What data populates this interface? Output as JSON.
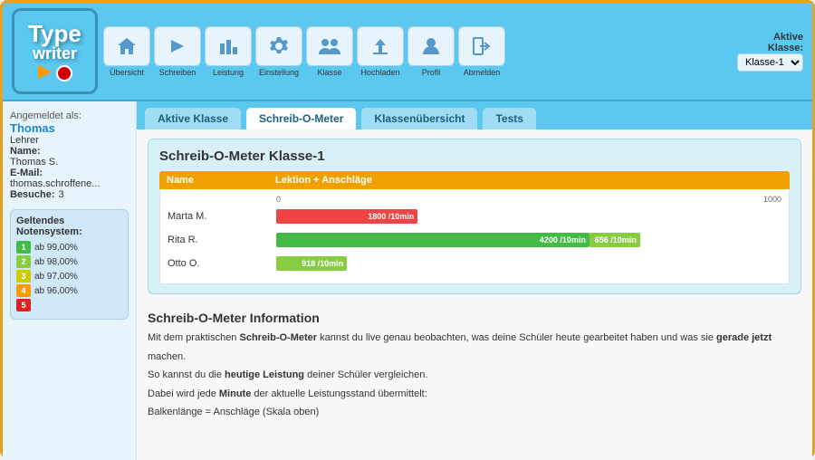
{
  "header": {
    "logo_line1": "Type",
    "logo_line2": "writer",
    "nav_items": [
      {
        "id": "uebersicht",
        "label": "Übersicht",
        "icon": "🏠"
      },
      {
        "id": "schreiben",
        "label": "Schreiben",
        "icon": "▶"
      },
      {
        "id": "leistung",
        "label": "Leistung",
        "icon": "🏛"
      },
      {
        "id": "einstellung",
        "label": "Einstellung",
        "icon": "🔧"
      },
      {
        "id": "klasse",
        "label": "Klasse",
        "icon": "👥"
      },
      {
        "id": "hochladen",
        "label": "Hochladen",
        "icon": "⬆"
      },
      {
        "id": "profil",
        "label": "Profil",
        "icon": "⚙"
      },
      {
        "id": "abmelden",
        "label": "Abmelden",
        "icon": "🚪"
      }
    ],
    "aktive_klasse_label": "Aktive\nKlasse:",
    "klasse_value": "Klasse-1"
  },
  "sidebar": {
    "angemeldet_label": "Angemeldet als:",
    "user_name": "Thomas",
    "role": "Lehrer",
    "name_label": "Name:",
    "name_value": "Thomas S.",
    "email_label": "E-Mail:",
    "email_value": "thomas.schroffene...",
    "besuche_label": "Besuche:",
    "besuche_value": "3",
    "grading_title": "Geltendes\nNotensystem:",
    "grades": [
      {
        "num": "1",
        "color": "#44bb44",
        "text": "ab 99,00%"
      },
      {
        "num": "2",
        "color": "#88cc44",
        "text": "ab 98,00%"
      },
      {
        "num": "3",
        "color": "#cccc00",
        "text": "ab 97,00%"
      },
      {
        "num": "4",
        "color": "#ff9900",
        "text": "ab 96,00%"
      },
      {
        "num": "5",
        "color": "#dd2222",
        "text": ""
      }
    ]
  },
  "tabs": [
    {
      "id": "aktive-klasse",
      "label": "Aktive Klasse",
      "active": false
    },
    {
      "id": "schreib-o-meter",
      "label": "Schreib-O-Meter",
      "active": true
    },
    {
      "id": "klassenuebersicht",
      "label": "Klassenübersicht",
      "active": false
    },
    {
      "id": "tests",
      "label": "Tests",
      "active": false
    }
  ],
  "som": {
    "title": "Schreib-O-Meter Klasse-1",
    "col_name": "Name",
    "col_lektion": "Lektion + Anschläge",
    "scale_min": "0",
    "scale_max": "1000",
    "students": [
      {
        "name": "Marta M.",
        "bar1_value": "1800 /10min",
        "bar1_width_pct": 28,
        "bar1_color": "#ee4444",
        "bar2_value": null,
        "bar2_width_pct": 0,
        "bar2_color": null
      },
      {
        "name": "Rita R.",
        "bar1_value": "4200 /10min",
        "bar1_width_pct": 62,
        "bar1_color": "#44bb44",
        "bar2_value": "656 /10min",
        "bar2_width_pct": 10,
        "bar2_color": "#88cc44"
      },
      {
        "name": "Otto O.",
        "bar1_value": "918 /10min",
        "bar1_width_pct": 14,
        "bar1_color": "#88cc44",
        "bar2_value": null,
        "bar2_width_pct": 0,
        "bar2_color": null
      }
    ]
  },
  "info": {
    "title": "Schreib-O-Meter Information",
    "text1_pre": "Mit dem praktischen ",
    "text1_bold": "Schreib-O-Meter",
    "text1_post": " kannst du live genau beobachten, was deine Schüler heute gearbeitet haben und was sie ",
    "text1_bold2": "gerade jetzt",
    "text1_end": "",
    "text2": "machen.",
    "text3": "So kannst du die ",
    "text3_bold": "heutige Leistung",
    "text3_post": " deiner Schüler vergleichen.",
    "text4": "Dabei wird jede ",
    "text4_bold": "Minute",
    "text4_post": " der aktuelle Leistungsstand übermittelt:",
    "text5": "Balkenlänge = Anschläge (Skala oben)"
  }
}
